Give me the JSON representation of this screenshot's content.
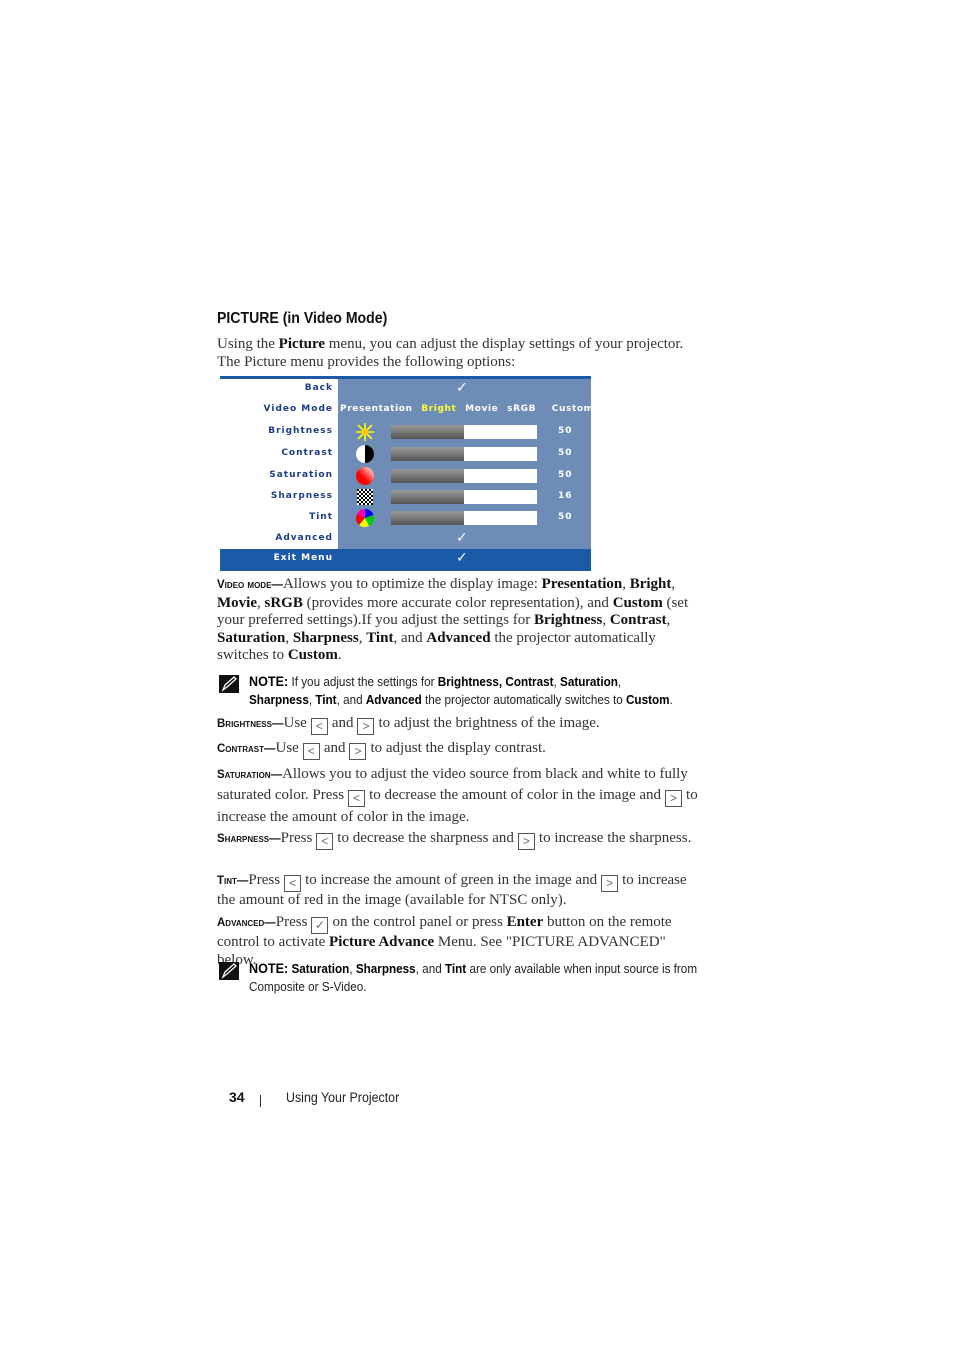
{
  "heading": "PICTURE (in Video Mode)",
  "intro": {
    "t1": "Using the ",
    "b1": "Picture",
    "t2": " menu, you can adjust the display settings of your projector. The Picture menu provides the following options:"
  },
  "menu": {
    "colors": {
      "panel": "#6e8db6",
      "label": "#1d3c88",
      "highlight": "#1b5aa6",
      "selected_mode": "#ffff33"
    },
    "rows": [
      {
        "label": "Back",
        "type": "check"
      },
      {
        "label": "Video Mode",
        "type": "modes"
      },
      {
        "label": "Brightness",
        "type": "slider",
        "icon": "sun-icon",
        "value": "50",
        "level": 0.5
      },
      {
        "label": "Contrast",
        "type": "slider",
        "icon": "contrast-icon",
        "value": "50",
        "level": 0.5
      },
      {
        "label": "Saturation",
        "type": "slider",
        "icon": "saturation-icon",
        "value": "50",
        "level": 0.5
      },
      {
        "label": "Sharpness",
        "type": "slider",
        "icon": "sharpness-icon",
        "value": "16",
        "level": 0.5
      },
      {
        "label": "Tint",
        "type": "slider",
        "icon": "tint-icon",
        "value": "50",
        "level": 0.5
      },
      {
        "label": "Advanced",
        "type": "check"
      }
    ],
    "modes": [
      "Presentation",
      "Bright",
      "Movie",
      "sRGB",
      "Custom"
    ],
    "selected_mode": "Bright",
    "exit_label": "Exit Menu",
    "check_glyph": "✓"
  },
  "video_mode": {
    "term": "Video mode—",
    "t1": "Allows you to optimize the display image: ",
    "b1": "Presentation",
    "c1": ", ",
    "b2": "Bright",
    "c2": ", ",
    "b3": "Movie",
    "c3": ", ",
    "b4": "sRGB",
    "t2": " (provides more accurate color representation), and ",
    "b5": "Custom",
    "t3": " (set your preferred settings).If you adjust the settings for ",
    "b6": "Brightness",
    "c4": ", ",
    "b7": "Contrast",
    "c5": ", ",
    "b8": "Saturation",
    "c6": ", ",
    "b9": "Sharpness",
    "c7": ", ",
    "b10": "Tint",
    "t4": ", and ",
    "b11": "Advanced",
    "t5": " the projector automatically switches to ",
    "b12": "Custom",
    "t6": "."
  },
  "note1": {
    "label": "NOTE:",
    "t1": " If you adjust the settings for ",
    "b1": "Brightness, Contrast",
    "c1": ", ",
    "b2": "Saturation",
    "c2": ",",
    "b3": "Sharpness",
    "c3": ", ",
    "b4": "Tint",
    "c4": ", and ",
    "b5": "Advanced",
    "t2": " the projector automatically switches to ",
    "b6": "Custom",
    "t3": "."
  },
  "brightness": {
    "term": "Brightness—",
    "t1": "Use",
    "and": "and",
    "t2": "to adjust the brightness of the image."
  },
  "contrast": {
    "term": "Contrast—",
    "t1": "Use",
    "and": "and",
    "t2": "to adjust the display contrast."
  },
  "saturation": {
    "term": "Saturation—",
    "t1": "Allows you to adjust the video source from black and white to fully saturated color. Press",
    "t2": "to decrease the amount of color in the image and",
    "t3": "to increase the amount of color in the image."
  },
  "sharpness": {
    "term": "Sharpness—",
    "t1": "Press",
    "t2": "to decrease the sharpness and",
    "t3": "to increase the sharpness."
  },
  "tint": {
    "term": "Tint—",
    "t1": "Press",
    "t2": "to increase the amount of green in the image and",
    "t3": "to increase the amount of red in the image (available for NTSC only)."
  },
  "advanced": {
    "term": "Advanced—",
    "t1": "Press",
    "t2": "on the control panel or press ",
    "b1": "Enter",
    "t3": " button on the remote control to activate ",
    "b2": "Picture Advance",
    "t4": " Menu. See \"PICTURE ADVANCED\" below."
  },
  "note2": {
    "label": "NOTE:",
    "b1": "Saturation",
    "c1": ", ",
    "b2": "Sharpness",
    "t1": ", and ",
    "b3": "Tint",
    "t2": " are only available when input source is from Composite or S-Video."
  },
  "keys": {
    "left": "<",
    "right": ">",
    "enter": "✓"
  },
  "footer": {
    "page": "34",
    "section": "Using Your Projector"
  }
}
